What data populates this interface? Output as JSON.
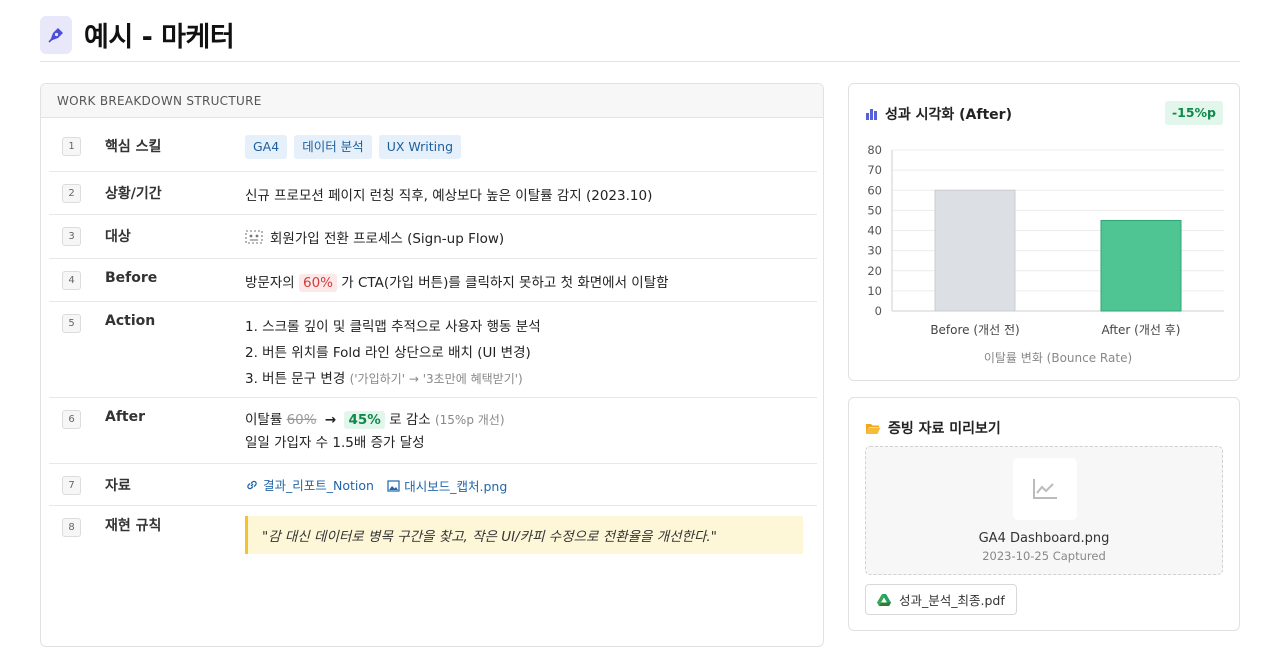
{
  "page": {
    "title": "예시 - 마케터",
    "logo_icon": "pen-nib-icon"
  },
  "wbs": {
    "header": "WORK BREAKDOWN STRUCTURE",
    "rows": [
      {
        "num": "1",
        "label": "핵심 스킬",
        "chips": [
          "GA4",
          "데이터 분석",
          "UX Writing"
        ]
      },
      {
        "num": "2",
        "label": "상황/기간",
        "text": "신규 프로모션 페이지 런칭 직후, 예상보다 높은 이탈률 감지 (2023.10)"
      },
      {
        "num": "3",
        "label": "대상",
        "icon": "selection-icon",
        "text": "회원가입 전환 프로세스 (Sign-up Flow)"
      },
      {
        "num": "4",
        "label": "Before",
        "pre": "방문자의",
        "highlight": "60%",
        "post": "가 CTA(가입 버튼)를 클릭하지 못하고 첫 화면에서 이탈함"
      },
      {
        "num": "5",
        "label": "Action",
        "items": [
          "1. 스크롤 깊이 및 클릭맵 추적으로 사용자 행동 분석",
          "2. 버튼 위치를 Fold 라인 상단으로 배치 (UI 변경)",
          "3. 버튼 문구 변경"
        ],
        "item3_note": "('가입하기' → '3초만에 혜택받기')"
      },
      {
        "num": "6",
        "label": "After",
        "pre": "이탈률",
        "old_value": "60%",
        "arrow": "→",
        "new_value": "45%",
        "post": "로 감소",
        "note": "(15%p 개선)",
        "line2": "일일 가입자 수 1.5배 증가 달성"
      },
      {
        "num": "7",
        "label": "자료",
        "links": [
          {
            "icon": "link-icon",
            "label": "결과_리포트_Notion"
          },
          {
            "icon": "image-icon",
            "label": "대시보드_캡처.png"
          }
        ]
      },
      {
        "num": "8",
        "label": "재현 규칙",
        "quote": "\"감 대신 데이터로 병목 구간을 찾고, 작은 UI/카피 수정으로 전환율을 개선한다.\""
      }
    ]
  },
  "chart_card": {
    "title": "성과 시각화 (After)",
    "icon": "bar-chart-icon",
    "badge": "-15%p",
    "colors": {
      "before": "#dcdfe4",
      "after": "#4fc594",
      "title_icon": "#5661d9"
    }
  },
  "chart_data": {
    "type": "bar",
    "categories": [
      "Before (개선 전)",
      "After (개선 후)"
    ],
    "values": [
      60,
      45
    ],
    "xlabel": "이탈률 변화 (Bounce Rate)",
    "ylabel": "",
    "ylim": [
      0,
      80
    ],
    "yticks": [
      0,
      10,
      20,
      30,
      40,
      50,
      60,
      70,
      80
    ],
    "grid": true
  },
  "evidence": {
    "title": "증빙 자료 미리보기",
    "icon": "folder-open-icon",
    "preview": {
      "icon": "line-chart-icon",
      "name": "GA4 Dashboard.png",
      "date": "2023-10-25 Captured"
    },
    "file": {
      "icon": "google-drive-icon",
      "label": "성과_분석_최종.pdf"
    }
  }
}
